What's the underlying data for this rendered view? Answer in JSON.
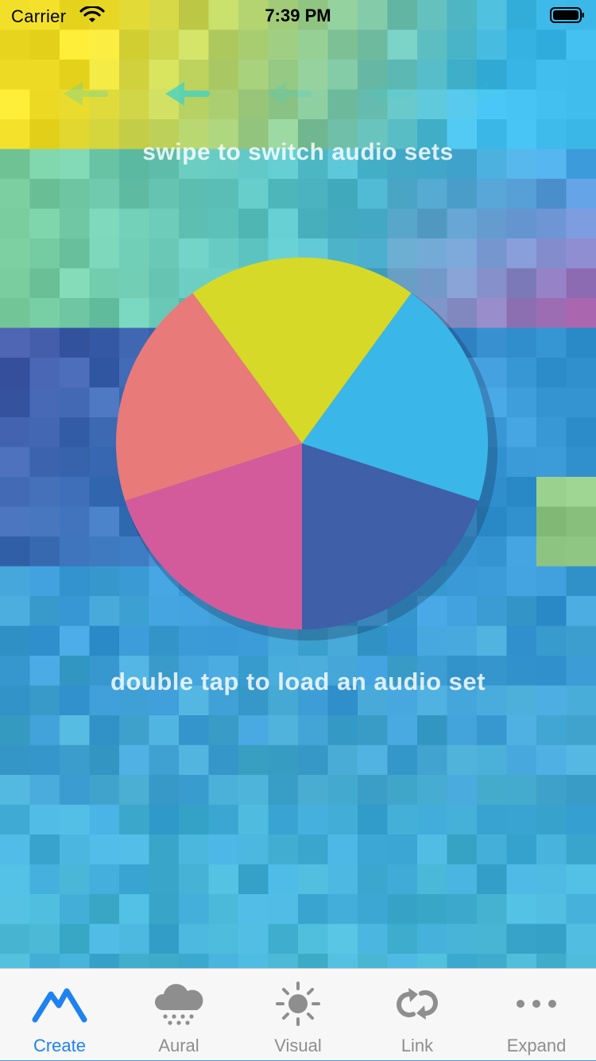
{
  "status_bar": {
    "carrier": "Carrier",
    "time": "7:39 PM"
  },
  "hints": {
    "swipe": "swipe to switch audio sets",
    "double_tap": "double tap to load an audio set"
  },
  "audio_wheel": {
    "segments": [
      {
        "name": "yellow",
        "color": "#d6d927"
      },
      {
        "name": "sky-blue",
        "color": "#3bb6e8"
      },
      {
        "name": "navy",
        "color": "#3f5fa8"
      },
      {
        "name": "magenta",
        "color": "#d35b9c"
      },
      {
        "name": "coral",
        "color": "#e97a7a"
      }
    ]
  },
  "tab_bar": {
    "active_color": "#1f82f0",
    "inactive_color": "#8e8e8e",
    "tabs": [
      {
        "label": "Create",
        "icon": "mountain-icon",
        "active": true
      },
      {
        "label": "Aural",
        "icon": "rain-cloud-icon",
        "active": false
      },
      {
        "label": "Visual",
        "icon": "sun-icon",
        "active": false
      },
      {
        "label": "Link",
        "icon": "loop-arrows-icon",
        "active": false
      },
      {
        "label": "Expand",
        "icon": "more-dots-icon",
        "active": false
      }
    ]
  }
}
